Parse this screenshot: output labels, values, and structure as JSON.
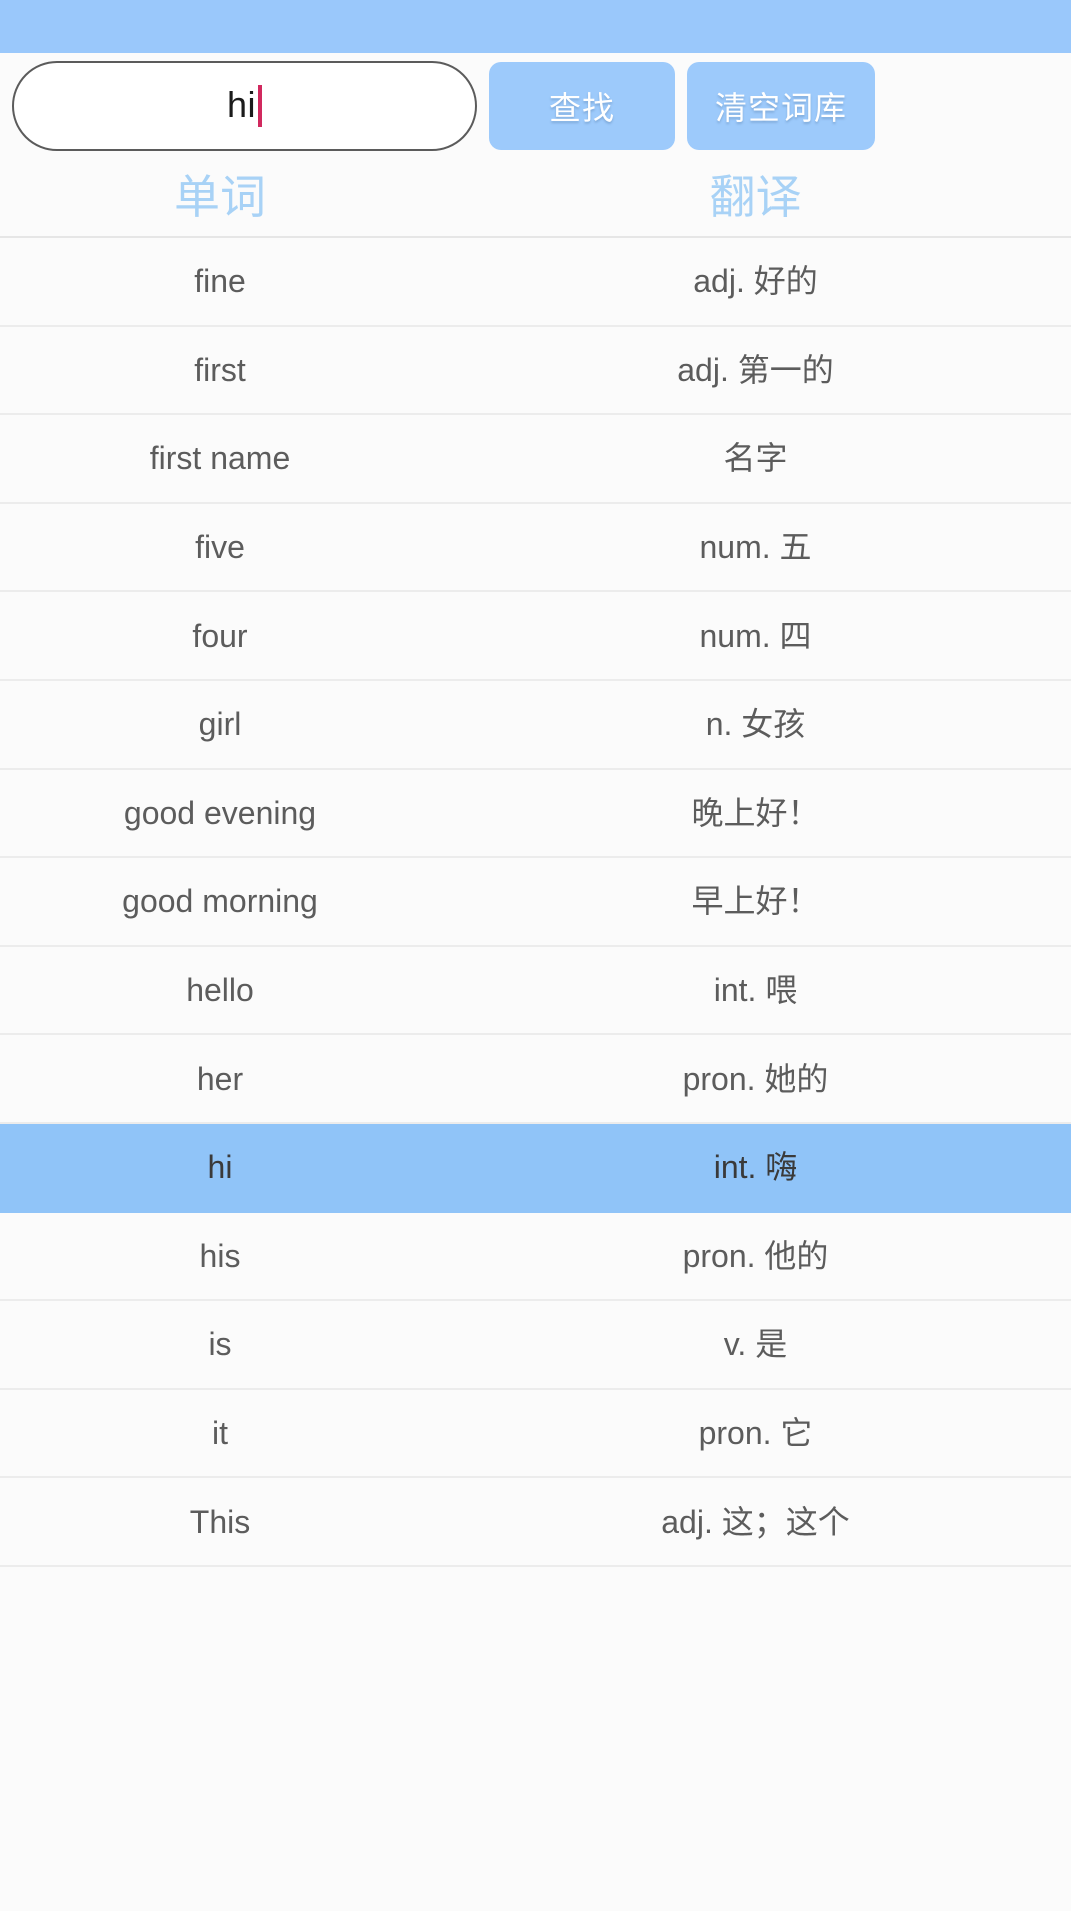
{
  "status_bar": {
    "color": "#9AC8FB"
  },
  "search": {
    "value": "hi",
    "placeholder": "",
    "caret_color": "#D1295E",
    "search_button_label": "查找",
    "clear_button_label": "清空词库",
    "button_color": "#9DCAFB"
  },
  "table": {
    "header_color": "#A8D2F6",
    "selected_row_color": "#90C4F8",
    "columns": [
      "单词",
      "翻译"
    ],
    "rows": [
      {
        "word": "fine",
        "translation": "adj. 好的",
        "selected": false
      },
      {
        "word": "first",
        "translation": "adj. 第一的",
        "selected": false
      },
      {
        "word": "first name",
        "translation": "名字",
        "selected": false
      },
      {
        "word": "five",
        "translation": "num. 五",
        "selected": false
      },
      {
        "word": "four",
        "translation": "num. 四",
        "selected": false
      },
      {
        "word": "girl",
        "translation": "n. 女孩",
        "selected": false
      },
      {
        "word": "good evening",
        "translation": "晚上好！",
        "selected": false
      },
      {
        "word": "good morning",
        "translation": "早上好！",
        "selected": false
      },
      {
        "word": "hello",
        "translation": "int. 喂",
        "selected": false
      },
      {
        "word": "her",
        "translation": "pron. 她的",
        "selected": false
      },
      {
        "word": "hi",
        "translation": "int. 嗨",
        "selected": true
      },
      {
        "word": "his",
        "translation": "pron. 他的",
        "selected": false
      },
      {
        "word": "is",
        "translation": "v. 是",
        "selected": false
      },
      {
        "word": "it",
        "translation": "pron. 它",
        "selected": false
      },
      {
        "word": "This",
        "translation": "adj. 这；这个",
        "selected": false
      }
    ]
  }
}
